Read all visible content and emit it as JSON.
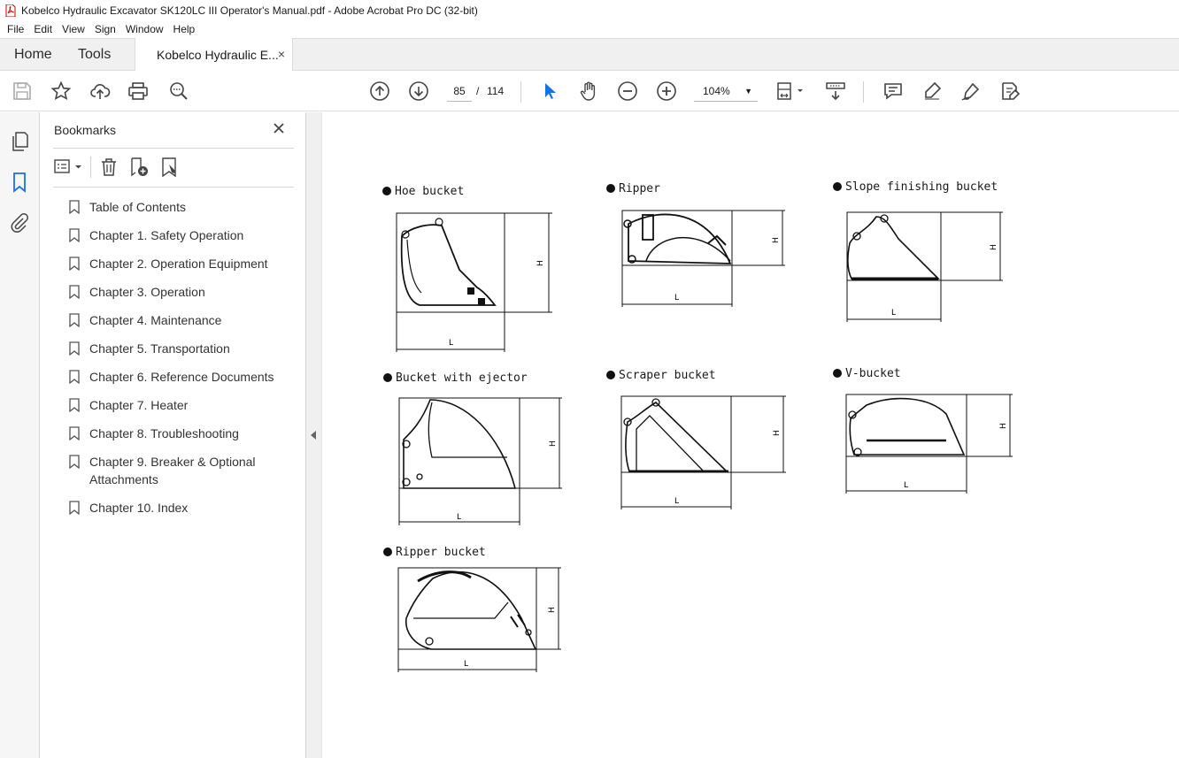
{
  "window": {
    "title": "Kobelco Hydraulic Excavator SK120LC III Operator's Manual.pdf - Adobe Acrobat Pro DC (32-bit)"
  },
  "menu": [
    "File",
    "Edit",
    "View",
    "Sign",
    "Window",
    "Help"
  ],
  "tabs": {
    "home": "Home",
    "tools": "Tools",
    "document": "Kobelco Hydraulic E...",
    "close": "×"
  },
  "toolbar": {
    "page_current": "85",
    "page_separator": "/",
    "page_total": "114",
    "zoom": "104%"
  },
  "bookmarks_panel": {
    "title": "Bookmarks",
    "items": [
      "Table of Contents",
      "Chapter 1. Safety Operation",
      "Chapter 2. Operation Equipment",
      "Chapter 3. Operation",
      "Chapter 4. Maintenance",
      "Chapter 5. Transportation",
      "Chapter 6. Reference Documents",
      "Chapter 7. Heater",
      "Chapter 8. Troubleshooting",
      "Chapter 9. Breaker & Optional Attachments",
      "Chapter 10. Index"
    ]
  },
  "document_page": {
    "figures": [
      {
        "label": "Hoe bucket"
      },
      {
        "label": "Ripper"
      },
      {
        "label": "Slope finishing bucket"
      },
      {
        "label": "Bucket with ejector"
      },
      {
        "label": "Scraper bucket"
      },
      {
        "label": "V-bucket"
      },
      {
        "label": "Ripper bucket"
      }
    ],
    "dim_h": "H",
    "dim_l": "L"
  },
  "colors": {
    "accent": "#1473e6",
    "chrome": "#f0f0f0"
  }
}
